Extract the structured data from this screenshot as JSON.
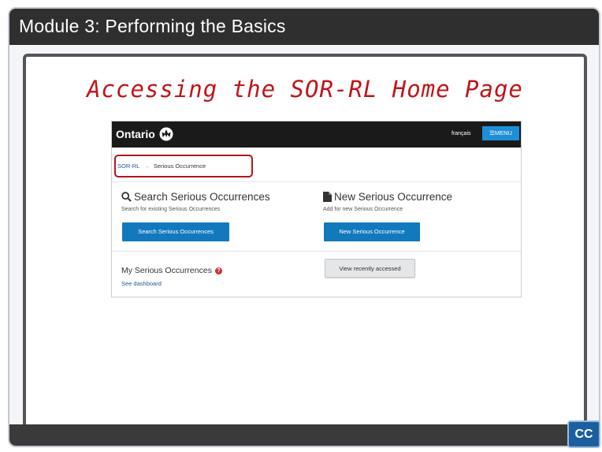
{
  "slide": {
    "header_title": "Module 3:  Performing the Basics",
    "title": "Accessing the SOR-RL Home Page",
    "cc_label": "CC"
  },
  "web": {
    "brand": "Ontario",
    "language_link": "français",
    "menu_label": "☰MENU",
    "breadcrumb": {
      "root": "SOR-RL",
      "arrow": "→",
      "current": "Serious Occurrence"
    },
    "search_card": {
      "title": "Search Serious Occurrences",
      "description": "Search for existing Serious Occurrences",
      "button": "Search Serious Occurrences",
      "icon": "search-icon"
    },
    "new_card": {
      "title": "New Serious Occurrence",
      "description": "Add for new Serious Occurrence",
      "button": "New Serious Occurrence",
      "icon": "document-icon"
    },
    "my_occurrences": {
      "title": "My Serious Occurrences",
      "help": "?",
      "link": "See dashboard"
    },
    "recent_button": "View recently accessed"
  },
  "colors": {
    "header_bar": "#2f2f2f",
    "title_red": "#c0141a",
    "primary_button": "#1279bd",
    "highlight": "#b3161c",
    "cc_button": "#1d5f9e"
  }
}
